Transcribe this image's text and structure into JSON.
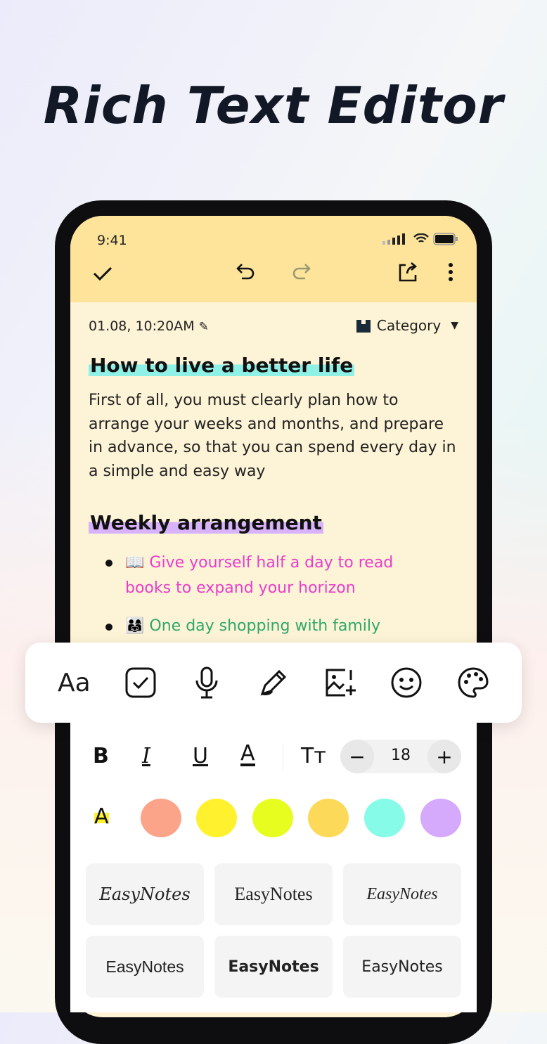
{
  "headline": "Rich Text Editor",
  "status_bar": {
    "time": "9:41"
  },
  "header": {
    "icons": [
      "check-icon",
      "undo-icon",
      "redo-icon",
      "share-icon",
      "more-vertical-icon"
    ]
  },
  "note": {
    "datetime": "01.08, 10:20AM",
    "category_label": "Category",
    "heading1": "How to live a better life",
    "heading1_highlight": "#8ff0e6",
    "paragraph": "First of all, you must clearly plan how to arrange your weeks and months, and prepare in advance, so that you can spend every day in a simple and easy way",
    "heading2": "Weekly arrangement",
    "heading2_highlight": "#d8b2fb",
    "bullets": [
      {
        "emoji": "📖",
        "text": "Give yourself half a day to read",
        "text2": "books to expand your horizon",
        "color": "#e93ec9"
      },
      {
        "emoji": "👨‍👩‍👧",
        "text": "One day shopping with family",
        "color": "#2ea86a"
      }
    ]
  },
  "toolbar": {
    "font_label": "Aa",
    "icons": [
      "font-icon",
      "checkbox-icon",
      "microphone-icon",
      "pen-icon",
      "image-add-icon",
      "emoji-icon",
      "palette-icon"
    ]
  },
  "format": {
    "bold": "B",
    "italic": "I",
    "underline": "U",
    "text_color": "A",
    "size_icon": "Tт",
    "font_size": "18",
    "minus": "−",
    "plus": "+"
  },
  "highlight": {
    "label": "A",
    "colors": [
      "#fba48a",
      "#fff12e",
      "#e6fd1f",
      "#fdd95a",
      "#86fbe8",
      "#d5a9fb"
    ]
  },
  "fonts": [
    "EasyNotes",
    "EasyNotes",
    "EasyNotes",
    "EasyNotes",
    "EasyNotes",
    "EasyNotes"
  ]
}
